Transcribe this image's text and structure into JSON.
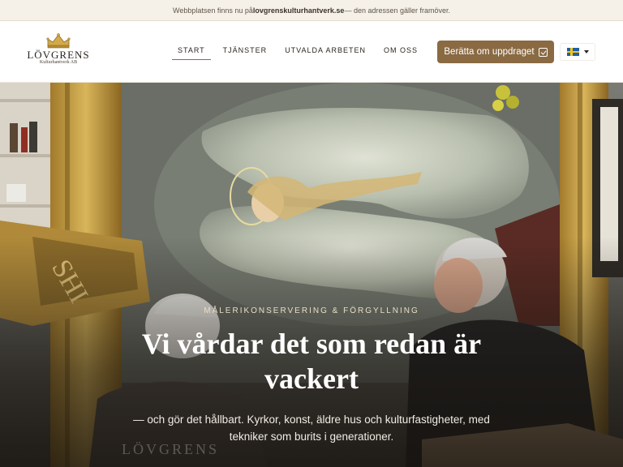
{
  "notice": {
    "before": "Webbplatsen finns nu på ",
    "domain": "lovgrenskulturhantverk.se",
    "after": " — den adressen gäller framöver."
  },
  "logo": {
    "name": "LÖVGRENS",
    "subtitle": "Kulturhantverk AB",
    "icon": "crown-icon"
  },
  "nav": {
    "items": [
      {
        "label": "START",
        "active": true
      },
      {
        "label": "TJÄNSTER",
        "active": false
      },
      {
        "label": "UTVALDA ARBETEN",
        "active": false
      },
      {
        "label": "OM OSS",
        "active": false
      }
    ]
  },
  "cta": {
    "label": "Berätta om uppdraget",
    "icon": "checkbox-edit-icon"
  },
  "language": {
    "icon": "swedish-flag-icon",
    "caret_icon": "caret-down-icon"
  },
  "hero": {
    "eyebrow": "MÅLERIKONSERVERING & FÖRGYLLNING",
    "title": "Vi vårdar det som redan är vackert",
    "subtitle": "— och gör det hållbart. Kyrkor, konst, äldre hus och kulturfastigheter, med tekniker som burits i generationer.",
    "background_text": "LÖVGRENS"
  },
  "colors": {
    "accent": "#8a6a42",
    "notice_bg": "#f5f0e8",
    "text": "#2b2520"
  }
}
